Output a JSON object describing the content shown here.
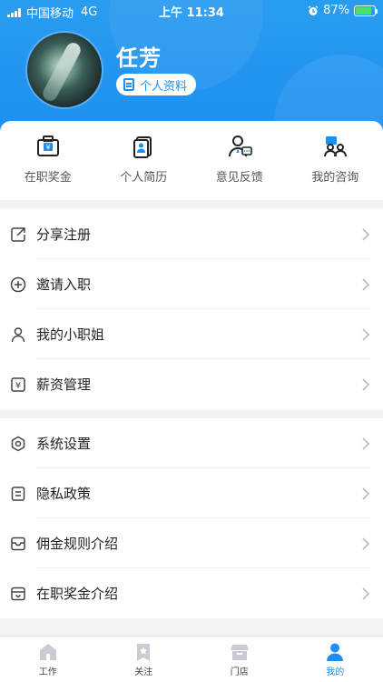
{
  "status_bar": {
    "carrier": "中国移动",
    "network": "4G",
    "time": "上午 11:34",
    "battery_percent": "87%",
    "battery_level": 0.87
  },
  "profile": {
    "name": "任芳",
    "profile_button": "个人资料"
  },
  "quick_actions": [
    {
      "label": "在职奖金",
      "icon": "wallet-bonus-icon"
    },
    {
      "label": "个人简历",
      "icon": "resume-icon"
    },
    {
      "label": "意见反馈",
      "icon": "feedback-icon"
    },
    {
      "label": "我的咨询",
      "icon": "consult-icon"
    }
  ],
  "menu_group_1": [
    {
      "label": "分享注册",
      "icon": "share-icon"
    },
    {
      "label": "邀请入职",
      "icon": "plus-circle-icon"
    },
    {
      "label": "我的小职姐",
      "icon": "person-icon"
    },
    {
      "label": "薪资管理",
      "icon": "yen-icon"
    }
  ],
  "menu_group_2": [
    {
      "label": "系统设置",
      "icon": "settings-icon"
    },
    {
      "label": "隐私政策",
      "icon": "document-icon"
    },
    {
      "label": "佣金规则介绍",
      "icon": "inbox-icon"
    },
    {
      "label": "在职奖金介绍",
      "icon": "bonus-intro-icon"
    }
  ],
  "tab_bar": [
    {
      "label": "工作",
      "icon": "home-icon",
      "active": false
    },
    {
      "label": "关注",
      "icon": "bookmark-star-icon",
      "active": false
    },
    {
      "label": "门店",
      "icon": "store-icon",
      "active": false
    },
    {
      "label": "我的",
      "icon": "user-icon",
      "active": true
    }
  ],
  "colors": {
    "brand_blue": "#1d8ff0",
    "battery_green": "#46e06a",
    "inactive_icon": "#c9cdd3"
  }
}
